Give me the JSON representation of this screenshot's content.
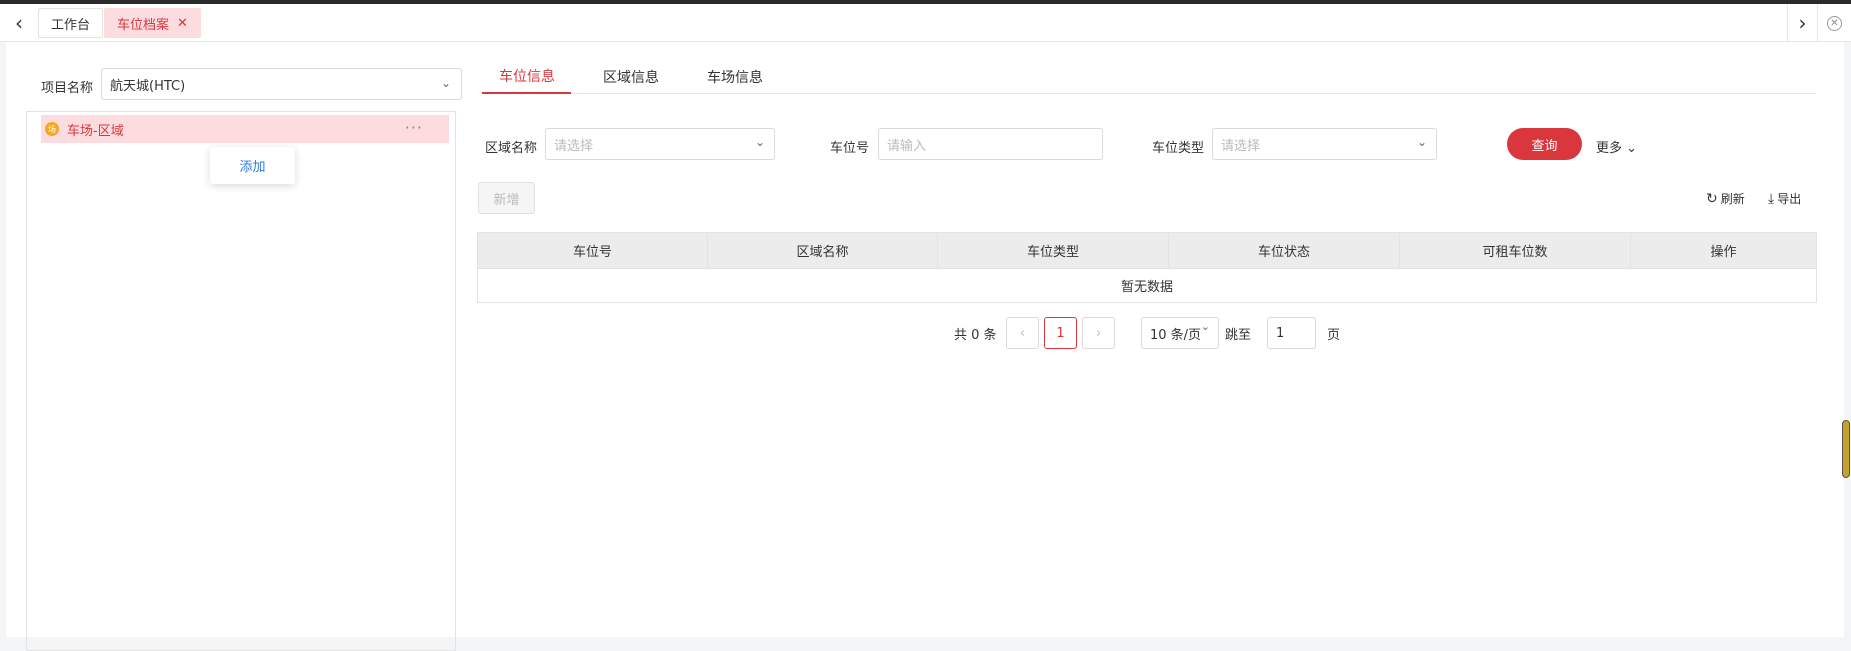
{
  "tabs": {
    "home_label": "工作台",
    "active_label": "车位档案",
    "close_glyph": "✕"
  },
  "left": {
    "project_label": "项目名称",
    "project_value": "航天城(HTC)",
    "tree_node": "车场-区域",
    "tree_node_icon_text": "场",
    "more_glyph": "···",
    "popover_add": "添加"
  },
  "right": {
    "tabs": [
      "车位信息",
      "区域信息",
      "车场信息"
    ],
    "filters": {
      "area_label": "区域名称",
      "area_placeholder": "请选择",
      "spot_label": "车位号",
      "spot_placeholder": "请输入",
      "type_label": "车位类型",
      "type_placeholder": "请选择"
    },
    "query_button": "查询",
    "more_label": "更多",
    "add_button": "新增",
    "refresh_label": "刷新",
    "export_label": "导出",
    "table": {
      "columns": [
        "车位号",
        "区域名称",
        "车位类型",
        "车位状态",
        "可租车位数",
        "操作"
      ],
      "empty_text": "暂无数据"
    },
    "pagination": {
      "total_text": "共 0 条",
      "current_page": "1",
      "page_size": "10 条/页",
      "jump_label": "跳至",
      "jump_value": "1",
      "page_unit": "页"
    }
  }
}
